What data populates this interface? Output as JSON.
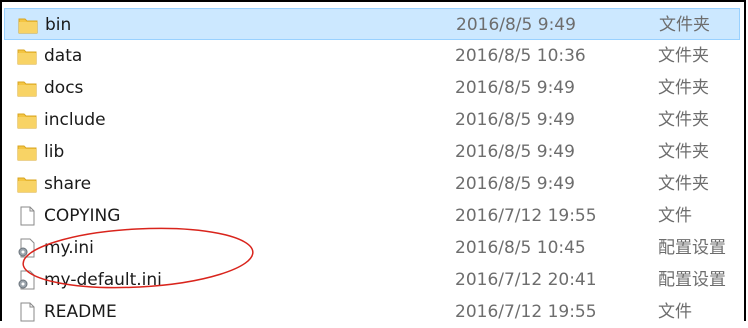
{
  "files": [
    {
      "name": "bin",
      "date": "2016/8/5 9:49",
      "type": "文件夹",
      "icon": "folder-icon",
      "selected": true
    },
    {
      "name": "data",
      "date": "2016/8/5 10:36",
      "type": "文件夹",
      "icon": "folder-icon"
    },
    {
      "name": "docs",
      "date": "2016/8/5 9:49",
      "type": "文件夹",
      "icon": "folder-icon"
    },
    {
      "name": "include",
      "date": "2016/8/5 9:49",
      "type": "文件夹",
      "icon": "folder-icon"
    },
    {
      "name": "lib",
      "date": "2016/8/5 9:49",
      "type": "文件夹",
      "icon": "folder-icon"
    },
    {
      "name": "share",
      "date": "2016/8/5 9:49",
      "type": "文件夹",
      "icon": "folder-icon"
    },
    {
      "name": "COPYING",
      "date": "2016/7/12 19:55",
      "type": "文件",
      "icon": "file-icon"
    },
    {
      "name": "my.ini",
      "date": "2016/8/5 10:45",
      "type": "配置设置",
      "icon": "settings-file-icon"
    },
    {
      "name": "my-default.ini",
      "date": "2016/7/12 20:41",
      "type": "配置设置",
      "icon": "settings-file-icon"
    },
    {
      "name": "README",
      "date": "2016/7/12 19:55",
      "type": "文件",
      "icon": "file-icon"
    }
  ],
  "colors": {
    "selection_bg": "#cce8ff",
    "folder": "#f0c050",
    "annotation": "#d9241c"
  }
}
